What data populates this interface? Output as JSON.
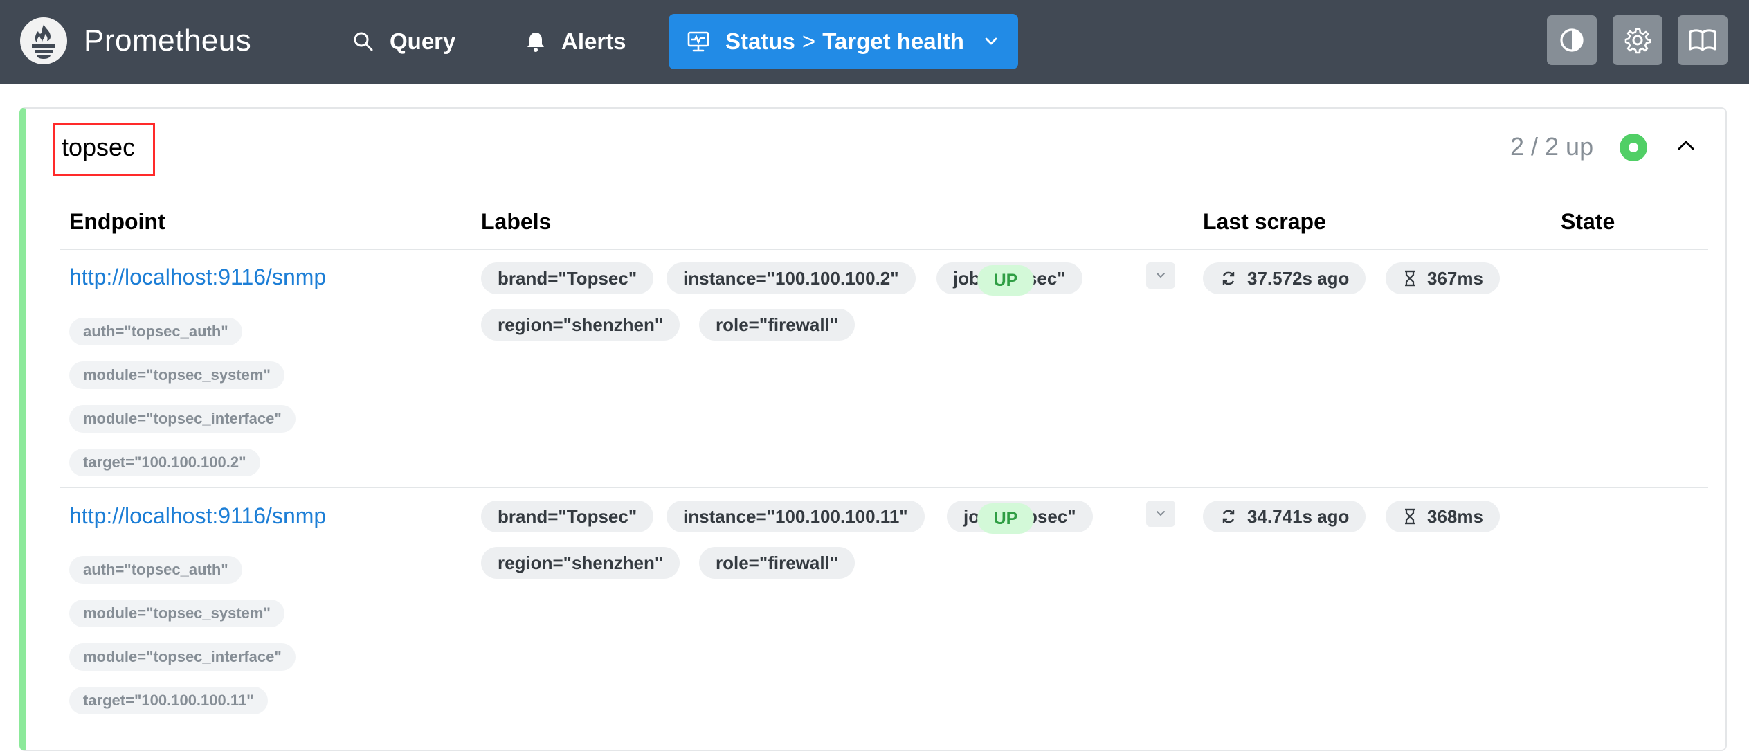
{
  "header": {
    "brand": "Prometheus",
    "nav": {
      "query": "Query",
      "alerts": "Alerts",
      "status_parent": "Status",
      "status_separator": ">",
      "status_current": "Target health"
    },
    "buttons": [
      "theme-toggle-icon",
      "settings-icon",
      "docs-book-icon"
    ]
  },
  "pool": {
    "name": "topsec",
    "summary": "2 / 2 up",
    "health_color": "#51cf66"
  },
  "table": {
    "columns": {
      "endpoint": "Endpoint",
      "labels": "Labels",
      "last_scrape": "Last scrape",
      "state": "State"
    },
    "rows": [
      {
        "endpoint": "http://localhost:9116/snmp",
        "params": [
          "auth=\"topsec_auth\"",
          "module=\"topsec_system\"",
          "module=\"topsec_interface\"",
          "target=\"100.100.100.2\""
        ],
        "labels": [
          "brand=\"Topsec\"",
          "instance=\"100.100.100.2\"",
          "job=\"topsec\"",
          "region=\"shenzhen\"",
          "role=\"firewall\""
        ],
        "last_scrape": "37.572s ago",
        "duration": "367ms",
        "state": "UP"
      },
      {
        "endpoint": "http://localhost:9116/snmp",
        "params": [
          "auth=\"topsec_auth\"",
          "module=\"topsec_system\"",
          "module=\"topsec_interface\"",
          "target=\"100.100.100.11\""
        ],
        "labels": [
          "brand=\"Topsec\"",
          "instance=\"100.100.100.11\"",
          "job=\"topsec\"",
          "region=\"shenzhen\"",
          "role=\"firewall\""
        ],
        "last_scrape": "34.741s ago",
        "duration": "368ms",
        "state": "UP"
      }
    ]
  },
  "colors": {
    "header_bg": "#414954",
    "accent": "#228be6",
    "link": "#1c7ed6",
    "up_badge_bg": "#d3f9d8",
    "up_badge_text": "#2f9e44",
    "card_border_healthy": "#8ce99a"
  }
}
